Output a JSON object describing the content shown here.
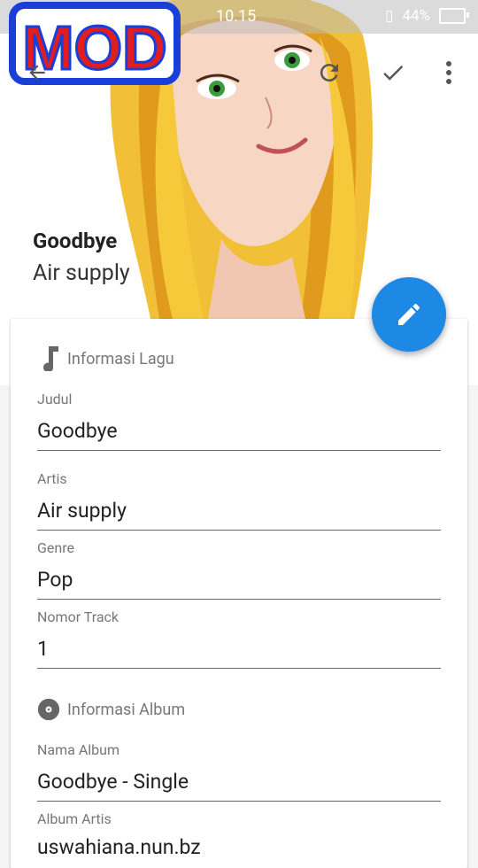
{
  "status_bar": {
    "left": ".ıl  ıl  ⌖",
    "time": "10.15",
    "battery": "44%"
  },
  "badge": {
    "text": "MOD"
  },
  "header": {
    "title": "Goodbye",
    "artist": "Air supply"
  },
  "sections": {
    "song": "Informasi Lagu",
    "album": "Informasi Album"
  },
  "fields": {
    "title": {
      "label": "Judul",
      "value": "Goodbye"
    },
    "artist": {
      "label": "Artis",
      "value": "Air supply"
    },
    "genre": {
      "label": "Genre",
      "value": "Pop"
    },
    "track": {
      "label": "Nomor Track",
      "value": "1"
    },
    "album_name": {
      "label": "Nama Album",
      "value": "Goodbye - Single"
    },
    "album_artist": {
      "label": "Album Artis",
      "value": "uswahiana.nun.bz"
    }
  },
  "colors": {
    "fab": "#1e88e5",
    "accent_text": "#222222"
  },
  "icons": [
    "back-arrow-icon",
    "refresh-icon",
    "check-icon",
    "more-vert-icon",
    "music-note-icon",
    "disc-icon",
    "pencil-icon"
  ]
}
